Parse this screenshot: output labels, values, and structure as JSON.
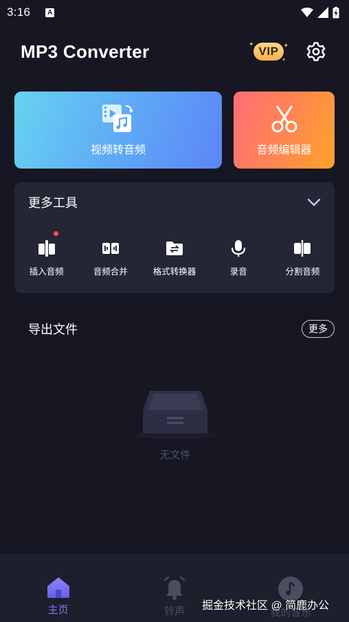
{
  "status_bar": {
    "time": "3:16",
    "a_badge": "A"
  },
  "header": {
    "title": "MP3 Converter",
    "vip": "VIP"
  },
  "cards": {
    "video_to_audio": "视频转音频",
    "audio_editor": "音频编辑器"
  },
  "more_tools": {
    "title": "更多工具",
    "items": [
      {
        "label": "插入音频",
        "icon": "insert-audio-icon",
        "has_dot": true
      },
      {
        "label": "音频合并",
        "icon": "merge-audio-icon"
      },
      {
        "label": "格式转换器",
        "icon": "format-convert-icon"
      },
      {
        "label": "录音",
        "icon": "microphone-icon"
      },
      {
        "label": "分割音频",
        "icon": "split-audio-icon"
      }
    ]
  },
  "export": {
    "title": "导出文件",
    "more": "更多",
    "empty_text": "无文件"
  },
  "bottom_nav": [
    {
      "label": "主页",
      "active": true
    },
    {
      "label": "铃声",
      "active": false
    },
    {
      "label": "我的音乐",
      "active": false
    }
  ],
  "watermark": "掘金技术社区 @ 简鹿办公",
  "colors": {
    "accent": "#7b78f2",
    "background": "#161722",
    "panel": "#242535",
    "red_dot": "#ff4d5a",
    "vip": "#f4b24b"
  }
}
